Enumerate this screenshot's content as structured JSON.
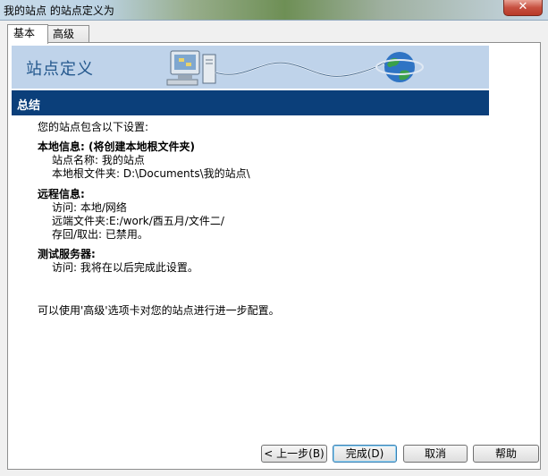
{
  "window": {
    "title": "我的站点 的站点定义为",
    "close_symbol": "✕"
  },
  "tabs": [
    {
      "label": "基本",
      "active": true
    },
    {
      "label": "高级",
      "active": false
    }
  ],
  "banner": {
    "title": "站点定义"
  },
  "section": {
    "title": "总结"
  },
  "summary": {
    "intro": "您的站点包含以下设置:",
    "local": {
      "heading": "本地信息: (将创建本地根文件夹)",
      "site_name": "站点名称: 我的站点",
      "root_folder": "本地根文件夹: D:\\Documents\\我的站点\\"
    },
    "remote": {
      "heading": "远程信息:",
      "access": "访问: 本地/网络",
      "remote_folder": "远端文件夹:E:/work/酉五月/文件二/",
      "checkinout": "存回/取出: 已禁用。"
    },
    "testing": {
      "heading": "测试服务器:",
      "access": "访问: 我将在以后完成此设置。"
    },
    "footer_note": "可以使用'高级'选项卡对您的站点进行进一步配置。"
  },
  "buttons": {
    "back": "< 上一步(B)",
    "done": "完成(D)",
    "cancel": "取消",
    "help": "帮助"
  },
  "colors": {
    "banner_bg": "#bfd3ea",
    "section_bg": "#0b3f7a",
    "banner_text": "#24588d"
  }
}
